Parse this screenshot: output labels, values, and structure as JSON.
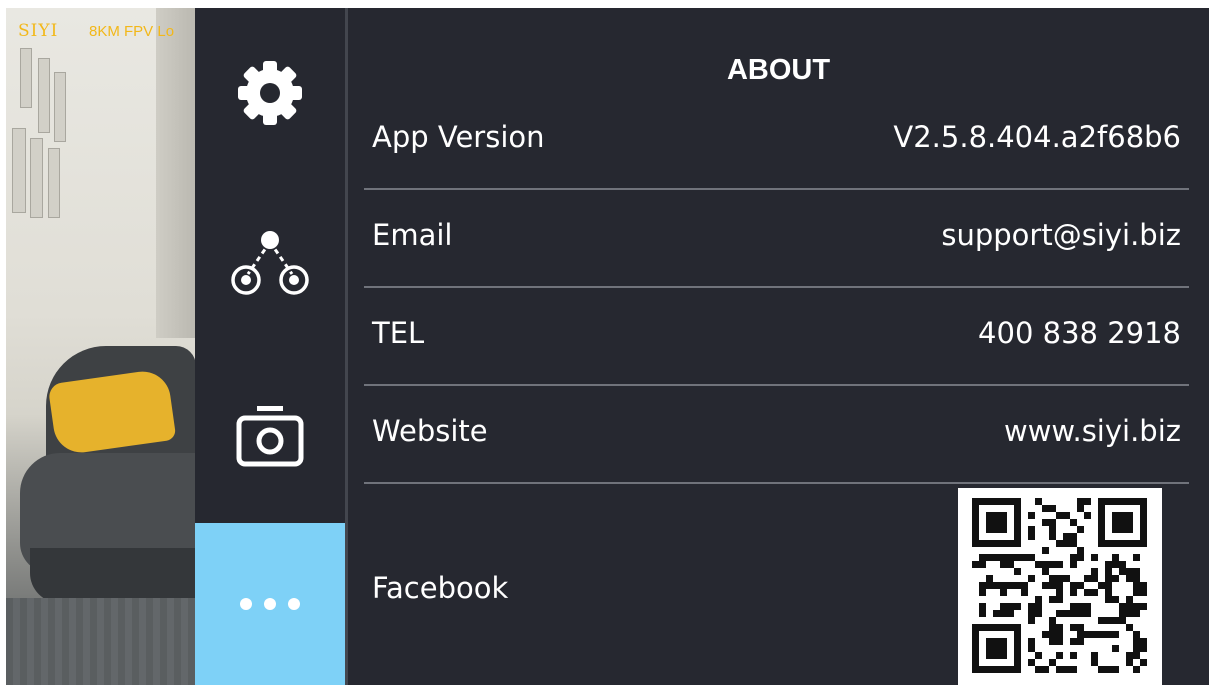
{
  "camera_overlay": {
    "brand": "SIYI",
    "tagline": "8KM FPV Lo"
  },
  "sidebar": {
    "items": [
      {
        "id": "settings",
        "icon": "gear-icon",
        "selected": false
      },
      {
        "id": "network",
        "icon": "link-nodes-icon",
        "selected": false
      },
      {
        "id": "camera",
        "icon": "camera-icon",
        "selected": false
      },
      {
        "id": "more",
        "icon": "more-dots-icon",
        "selected": true
      }
    ]
  },
  "about": {
    "title": "ABOUT",
    "rows": [
      {
        "label": "App Version",
        "value": "V2.5.8.404.a2f68b6"
      },
      {
        "label": "Email",
        "value": "support@siyi.biz"
      },
      {
        "label": "TEL",
        "value": "400 838 2918"
      },
      {
        "label": "Website",
        "value": "www.siyi.biz"
      },
      {
        "label": "Facebook"
      }
    ]
  },
  "colors": {
    "background": "#262830",
    "divider": "#70737b",
    "selected_tab": "#7ed1f7",
    "overlay_text": "#f2b81a",
    "text": "#ffffff"
  }
}
